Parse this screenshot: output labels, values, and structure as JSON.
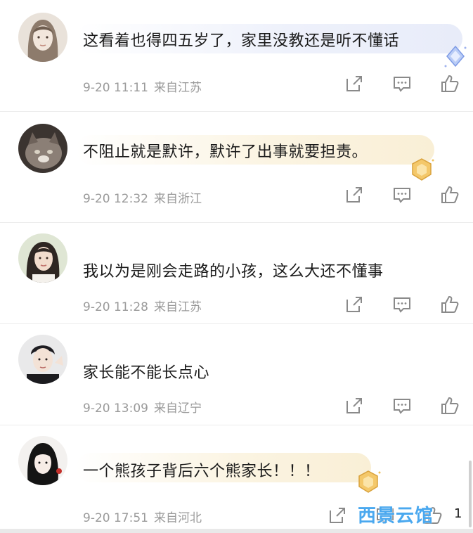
{
  "comments": [
    {
      "text": "这看着也得四五岁了，家里没教还是听不懂话",
      "date": "9-20 11:11",
      "location": "来自江苏",
      "badge": "diamond-blue",
      "avatar": "girl-sketch-avatar"
    },
    {
      "text": "不阻止就是默许，默许了出事就要担责。",
      "date": "9-20 12:32",
      "location": "来自浙江",
      "badge": "gold-crest",
      "avatar": "cat-avatar"
    },
    {
      "text": "我以为是刚会走路的小孩，这么大还不懂事",
      "date": "9-20 11:28",
      "location": "来自江苏",
      "badge": "",
      "avatar": "woman-photo-avatar"
    },
    {
      "text": "家长能不能长点心",
      "date": "9-20 13:09",
      "location": "来自辽宁",
      "badge": "",
      "avatar": "man-photo-avatar"
    },
    {
      "text": "一个熊孩子背后六个熊家长！！！",
      "date": "9-20 17:51",
      "location": "来自河北",
      "badge": "gold-crest",
      "avatar": "anime-girl-avatar",
      "like_count": "1"
    }
  ],
  "watermark": "西景云馆",
  "colors": {
    "text": "#1a1a1a",
    "meta": "#9a9a9a",
    "divider": "#ececec",
    "watermark": "#4aa8ef",
    "gold_bubble": "#f9efd6",
    "blue_bubble": "#e8ecf9"
  },
  "icons": {
    "share": "share-icon",
    "comment": "comment-icon",
    "like": "like-icon"
  }
}
